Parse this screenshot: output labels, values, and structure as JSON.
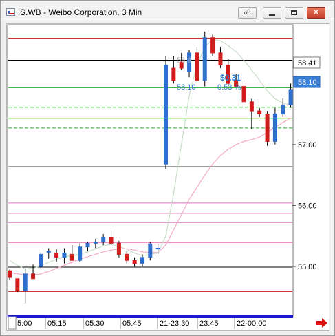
{
  "window": {
    "title": "S.WB - Weibo Corporation, 3 Min",
    "link_icon": "chain-link-icon",
    "minimize_icon": "minimize-icon",
    "restore_icon": "restore-icon",
    "close_icon": "close-icon"
  },
  "colors": {
    "up_candle": "#2f6fd0",
    "down_candle": "#d01c1c",
    "price_tag_current": "#3a7fd8",
    "price_tag_prev": "#ffffff",
    "session_bar": "#1a1acc",
    "session_bar_active": "#e81010",
    "stop_line": "#c01818",
    "support_line": "#20b020",
    "ma_fast": "#c8dcc8",
    "ma_slow": "#f4a8c8"
  },
  "price_labels": {
    "prev_close_tag": "58.41",
    "last_price_tag": "58.10"
  },
  "overlay": {
    "faded_price": "58.3",
    "change_amount": "$0.31",
    "ref_price": "58.10",
    "change_percent": "0.53 %"
  },
  "scroll_arrow_icon": "red-right-arrow-icon",
  "chart_data": {
    "type": "candlestick",
    "y_tick_labels": [
      "57.00",
      "56.00",
      "55.00"
    ],
    "x_tick_labels": [
      "5:00",
      "05:15",
      "05:30",
      "05:45",
      "21-23:30",
      "23:45",
      "22-00:00"
    ],
    "ylim": [
      54.2,
      58.95
    ],
    "levels": [
      {
        "value": 58.74,
        "color": "#c01818",
        "style": "solid"
      },
      {
        "value": 58.38,
        "color": "#000000",
        "style": "solid"
      },
      {
        "value": 57.93,
        "color": "#20b020",
        "style": "solid"
      },
      {
        "value": 57.61,
        "color": "#20b020",
        "style": "dashed"
      },
      {
        "value": 57.43,
        "color": "#20d020",
        "style": "solid"
      },
      {
        "value": 57.27,
        "color": "#20b020",
        "style": "dashed"
      },
      {
        "value": 56.64,
        "color": "#808080",
        "style": "solid"
      },
      {
        "value": 56.04,
        "color": "#e070c0",
        "style": "solid"
      },
      {
        "value": 55.87,
        "color": "#f090c0",
        "style": "solid"
      },
      {
        "value": 55.72,
        "color": "#e070c0",
        "style": "solid"
      },
      {
        "value": 55.39,
        "color": "#f090c0",
        "style": "solid"
      },
      {
        "value": 54.99,
        "color": "#000000",
        "style": "solid"
      },
      {
        "value": 54.59,
        "color": "#c01818",
        "style": "solid"
      }
    ],
    "candles": [
      {
        "o": 54.93,
        "h": 54.95,
        "l": 54.78,
        "c": 54.82
      },
      {
        "o": 54.8,
        "h": 54.8,
        "l": 54.58,
        "c": 54.6
      },
      {
        "o": 54.6,
        "h": 54.97,
        "l": 54.4,
        "c": 54.88
      },
      {
        "o": 54.88,
        "h": 55.03,
        "l": 54.8,
        "c": 54.8
      },
      {
        "o": 55.0,
        "h": 55.24,
        "l": 54.95,
        "c": 55.2
      },
      {
        "o": 55.23,
        "h": 55.3,
        "l": 55.13,
        "c": 55.25
      },
      {
        "o": 55.22,
        "h": 55.28,
        "l": 55.08,
        "c": 55.15
      },
      {
        "o": 55.15,
        "h": 55.3,
        "l": 55.05,
        "c": 55.22
      },
      {
        "o": 55.2,
        "h": 55.35,
        "l": 55.1,
        "c": 55.1
      },
      {
        "o": 55.1,
        "h": 55.38,
        "l": 55.08,
        "c": 55.32
      },
      {
        "o": 55.32,
        "h": 55.4,
        "l": 55.25,
        "c": 55.38
      },
      {
        "o": 55.38,
        "h": 55.45,
        "l": 55.3,
        "c": 55.4
      },
      {
        "o": 55.4,
        "h": 55.53,
        "l": 55.35,
        "c": 55.48
      },
      {
        "o": 55.48,
        "h": 55.58,
        "l": 55.35,
        "c": 55.38
      },
      {
        "o": 55.38,
        "h": 55.42,
        "l": 55.15,
        "c": 55.2
      },
      {
        "o": 55.2,
        "h": 55.25,
        "l": 55.05,
        "c": 55.1
      },
      {
        "o": 55.1,
        "h": 55.15,
        "l": 55.0,
        "c": 55.05
      },
      {
        "o": 55.05,
        "h": 55.2,
        "l": 55.0,
        "c": 55.15
      },
      {
        "o": 55.15,
        "h": 55.4,
        "l": 55.1,
        "c": 55.37
      },
      {
        "o": 55.3,
        "h": 55.37,
        "l": 55.2,
        "c": 55.3
      },
      {
        "o": 56.68,
        "h": 58.45,
        "l": 56.6,
        "c": 58.3
      },
      {
        "o": 58.25,
        "h": 58.45,
        "l": 58.0,
        "c": 58.05
      },
      {
        "o": 58.35,
        "h": 58.5,
        "l": 58.22,
        "c": 58.25
      },
      {
        "o": 58.2,
        "h": 58.55,
        "l": 58.1,
        "c": 58.5
      },
      {
        "o": 58.5,
        "h": 58.6,
        "l": 58.0,
        "c": 58.05
      },
      {
        "o": 58.05,
        "h": 58.85,
        "l": 57.95,
        "c": 58.75
      },
      {
        "o": 58.75,
        "h": 58.8,
        "l": 58.45,
        "c": 58.5
      },
      {
        "o": 58.5,
        "h": 58.6,
        "l": 58.25,
        "c": 58.3
      },
      {
        "o": 58.3,
        "h": 58.4,
        "l": 57.95,
        "c": 58.0
      },
      {
        "o": 58.05,
        "h": 58.15,
        "l": 57.95,
        "c": 57.95
      },
      {
        "o": 57.95,
        "h": 58.05,
        "l": 57.6,
        "c": 57.7
      },
      {
        "o": 57.7,
        "h": 57.75,
        "l": 57.25,
        "c": 57.55
      },
      {
        "o": 57.55,
        "h": 57.6,
        "l": 57.45,
        "c": 57.5
      },
      {
        "o": 57.5,
        "h": 57.55,
        "l": 56.98,
        "c": 57.05
      },
      {
        "o": 57.05,
        "h": 57.6,
        "l": 57.0,
        "c": 57.5
      },
      {
        "o": 57.5,
        "h": 57.75,
        "l": 57.45,
        "c": 57.65
      },
      {
        "o": 57.65,
        "h": 58.0,
        "l": 57.6,
        "c": 57.9
      }
    ],
    "ma_fast": [
      55.1,
      55.02,
      54.96,
      54.97,
      55.01,
      55.07,
      55.12,
      55.16,
      55.18,
      55.2,
      55.24,
      55.29,
      55.34,
      55.36,
      55.33,
      55.28,
      55.22,
      55.18,
      55.2,
      55.22,
      55.5,
      56.2,
      57.0,
      57.8,
      58.3,
      58.6,
      58.72,
      58.7,
      58.62,
      58.52,
      58.38,
      58.22,
      58.05,
      57.88,
      57.75,
      57.68,
      57.65
    ],
    "ma_slow": [
      54.9,
      54.88,
      54.86,
      54.86,
      54.88,
      54.92,
      54.97,
      55.02,
      55.07,
      55.12,
      55.16,
      55.2,
      55.24,
      55.27,
      55.29,
      55.29,
      55.27,
      55.24,
      55.23,
      55.23,
      55.35,
      55.6,
      55.85,
      56.1,
      56.3,
      56.5,
      56.68,
      56.82,
      56.92,
      57.0,
      57.05,
      57.08,
      57.12,
      57.2,
      57.28,
      57.36,
      57.43
    ]
  }
}
